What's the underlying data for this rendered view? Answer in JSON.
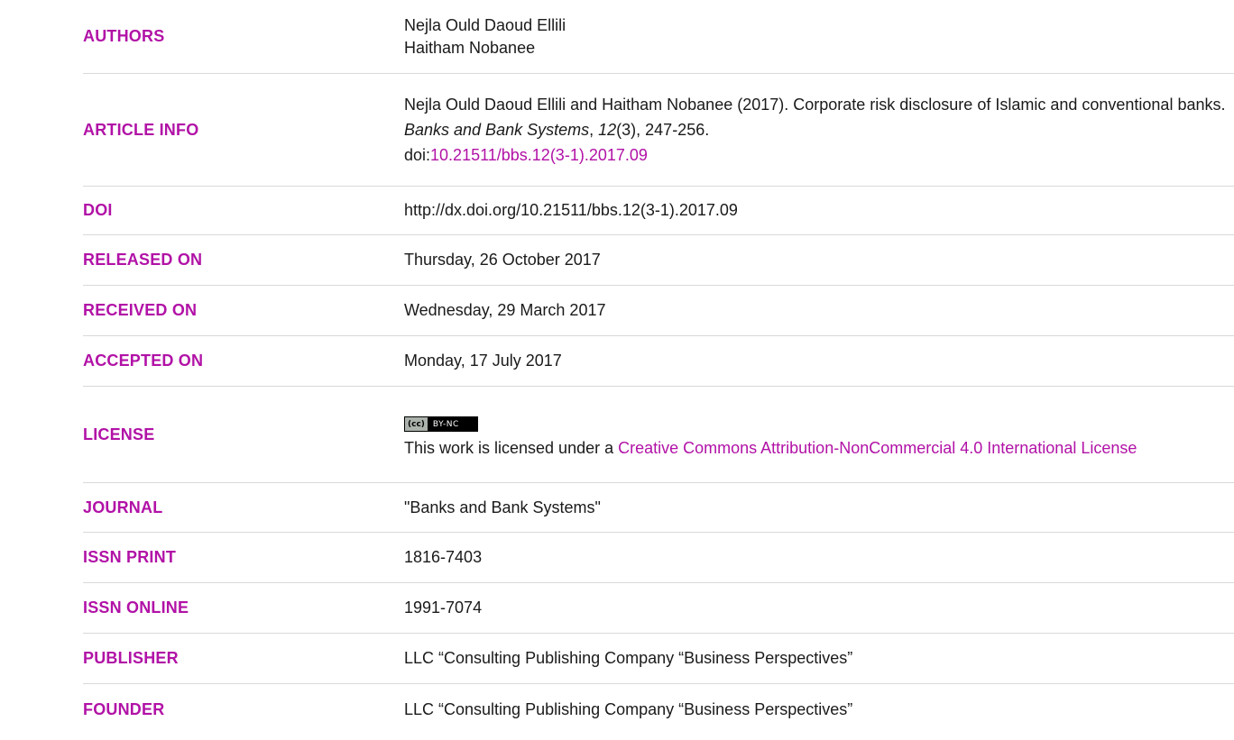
{
  "rows": [
    {
      "label": "AUTHORS"
    },
    {
      "label": "ARTICLE INFO"
    },
    {
      "label": "DOI"
    },
    {
      "label": "RELEASED ON"
    },
    {
      "label": "RECEIVED ON"
    },
    {
      "label": "ACCEPTED ON"
    },
    {
      "label": "LICENSE"
    },
    {
      "label": "JOURNAL"
    },
    {
      "label": "ISSN PRINT"
    },
    {
      "label": "ISSN ONLINE"
    },
    {
      "label": "PUBLISHER"
    },
    {
      "label": "FOUNDER"
    }
  ],
  "authors": [
    "Nejla Ould Daoud Ellili",
    "Haitham Nobanee"
  ],
  "article_info": {
    "citation_start": "Nejla Ould Daoud Ellili and Haitham Nobanee (2017). Corporate risk disclosure of Islamic and conventional banks. ",
    "journal_italic": "Banks and Bank Systems",
    "comma1": ", ",
    "volume_italic": "12",
    "issue_pages": "(3), 247-256.",
    "doi_prefix": "doi:",
    "doi_link": "10.21511/bbs.12(3-1).2017.09"
  },
  "doi": "http://dx.doi.org/10.21511/bbs.12(3-1).2017.09",
  "released_on": "Thursday, 26 October 2017",
  "received_on": "Wednesday, 29 March 2017",
  "accepted_on": "Monday, 17 July 2017",
  "license": {
    "badge_left": "(cc)",
    "badge_right": "BY-NC",
    "text_prefix": "This work is licensed under a ",
    "link_text": "Creative Commons Attribution-NonCommercial 4.0 International License"
  },
  "journal": "\"Banks and Bank Systems\"",
  "issn_print": "1816-7403",
  "issn_online": "1991-7074",
  "publisher": "LLC “Consulting Publishing Company “Business Perspectives”",
  "founder": "LLC “Consulting Publishing Company “Business Perspectives”",
  "colors": {
    "accent": "#b112a6",
    "text": "#1a1a1a",
    "divider": "#d9d9d9"
  }
}
